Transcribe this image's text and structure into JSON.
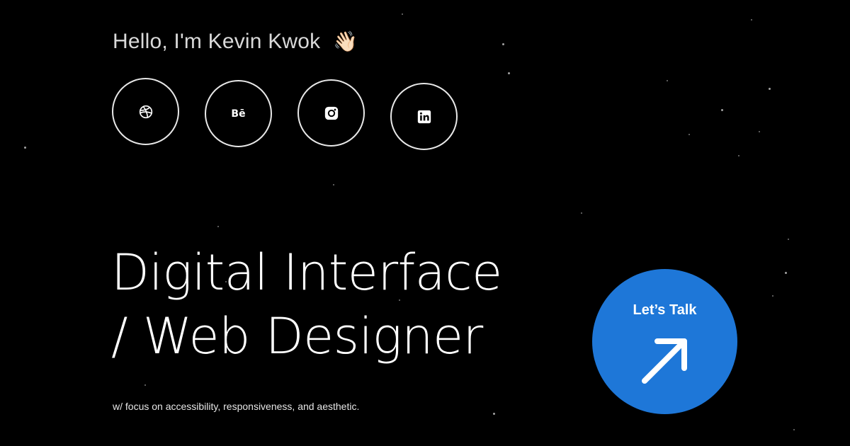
{
  "greeting": {
    "text": "Hello, I'm Kevin Kwok",
    "emoji": "👋🏻"
  },
  "social": [
    {
      "name": "dribbble",
      "icon": "dribbble-icon"
    },
    {
      "name": "behance",
      "icon": "behance-icon",
      "glyph": "Bē"
    },
    {
      "name": "instagram",
      "icon": "instagram-icon"
    },
    {
      "name": "linkedin",
      "icon": "linkedin-icon"
    }
  ],
  "headline": {
    "line1": "Digital Interface",
    "line2": "/ Web Designer"
  },
  "tagline": "w/ focus on accessibility, responsiveness, and aesthetic.",
  "cta": {
    "label": "Let’s Talk",
    "icon": "arrow-up-right-icon"
  },
  "colors": {
    "background": "#000000",
    "accent": "#1e77d8",
    "text": "#ffffff"
  }
}
